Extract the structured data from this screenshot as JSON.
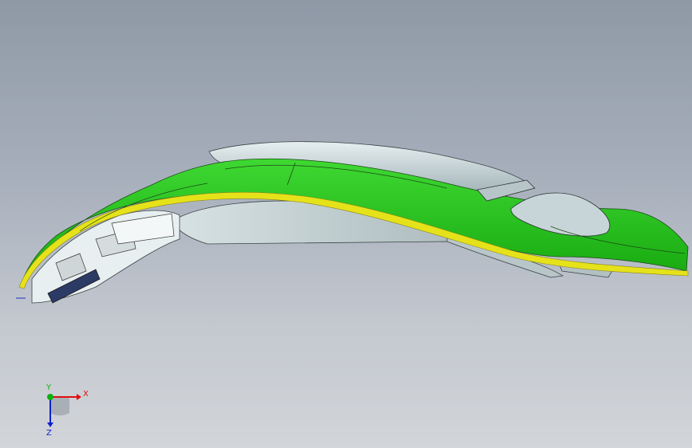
{
  "viewport": {
    "background_top": "#8f99a6",
    "background_bottom": "#d2d5d9"
  },
  "model": {
    "surface_color": "#22c41a",
    "edge_color": "#e6e21a",
    "body_color": "#c9d4d6"
  },
  "triad": {
    "x_label": "X",
    "y_label": "Y",
    "z_label": "Z",
    "x_color": "#e01010",
    "y_color": "#10b010",
    "z_color": "#1020d0"
  }
}
